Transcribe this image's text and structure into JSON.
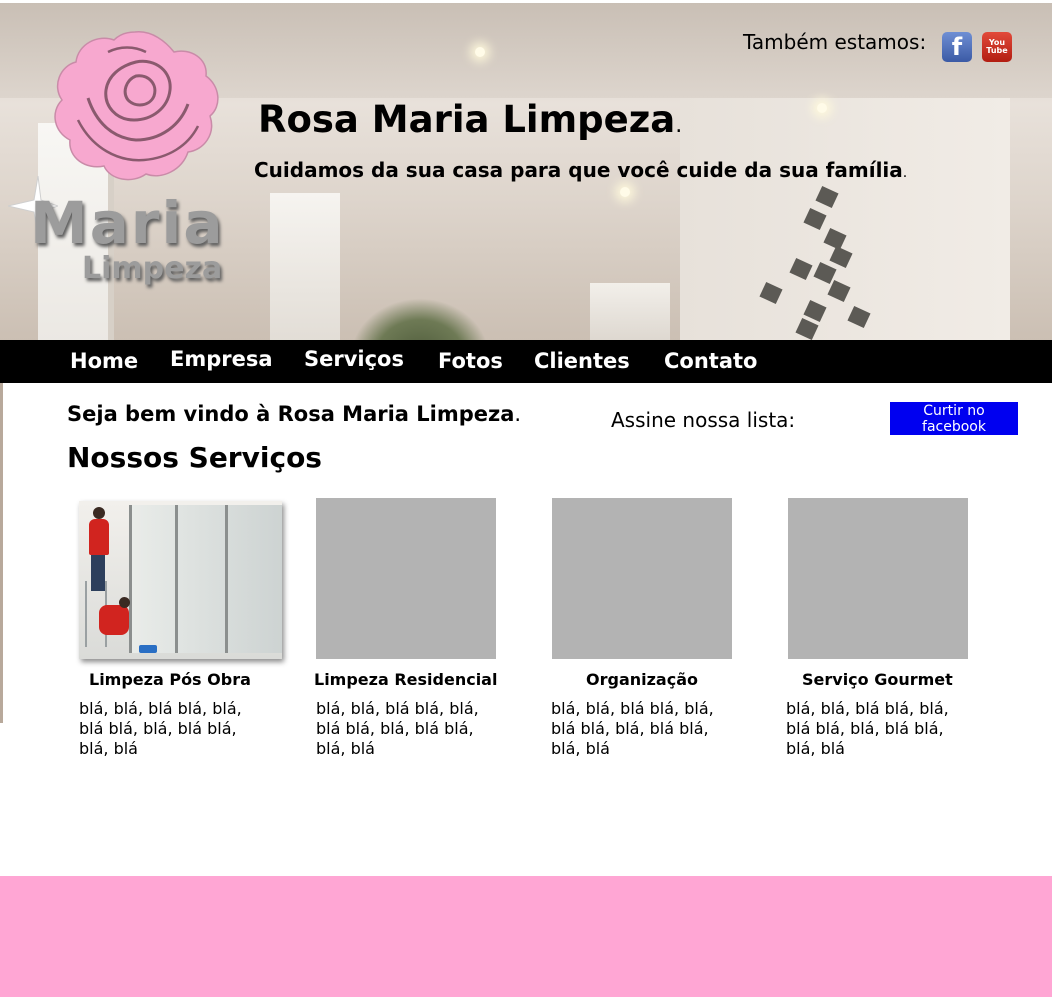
{
  "header": {
    "title": "Rosa Maria Limpeza",
    "title_dot": ".",
    "tagline": "Cuidamos da sua casa para que você cuide da sua família",
    "tagline_dot": ".",
    "social_label": "Também estamos:",
    "social_icons": [
      "facebook-icon",
      "youtube-icon"
    ],
    "youtube_text": [
      "You",
      "Tube"
    ],
    "logo_word_1": "Maria",
    "logo_word_2": "Limpeza",
    "colors": {
      "rose": "#f7a8cf",
      "facebook": "#3b5aa5",
      "youtube": "#c4281a"
    }
  },
  "nav": {
    "items": [
      "Home",
      "Empresa",
      "Serviços",
      "Fotos",
      "Clientes",
      "Contato"
    ],
    "colors": {
      "background": "#000000",
      "text": "#ffffff"
    }
  },
  "main": {
    "welcome": "Seja bem vindo à Rosa Maria Limpeza",
    "welcome_dot": ".",
    "signup_label": "Assine nossa lista:",
    "facebook_button": "Curtir no facebook",
    "section_title": "Nossos Serviços",
    "services": [
      {
        "name": "Limpeza Pós Obra",
        "description": "blá, blá, blá blá, blá, blá blá, blá, blá blá, blá, blá"
      },
      {
        "name": "Limpeza Residencial",
        "description": "blá, blá, blá blá, blá, blá blá, blá, blá blá, blá, blá"
      },
      {
        "name": "Organização",
        "description": "blá, blá, blá blá, blá, blá blá, blá, blá blá, blá, blá"
      },
      {
        "name": "Serviço Gourmet",
        "description": "blá, blá, blá blá, blá, blá blá, blá, blá blá, blá, blá"
      }
    ],
    "colors": {
      "facebook_button": "#0000f0",
      "placeholder": "#b3b3b3"
    }
  },
  "footer": {
    "color": "#ffa6d4"
  }
}
